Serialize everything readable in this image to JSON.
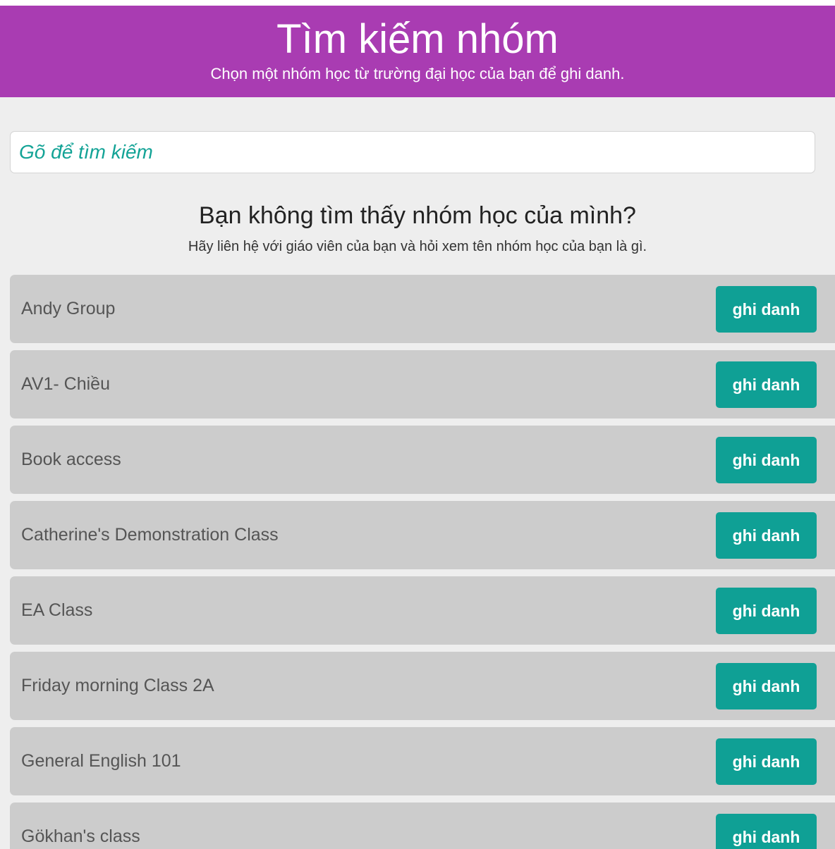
{
  "header": {
    "title": "Tìm kiếm nhóm",
    "subtitle": "Chọn một nhóm học từ trường đại học của bạn để ghi danh."
  },
  "search": {
    "placeholder": "Gõ để tìm kiếm",
    "value": ""
  },
  "not_found": {
    "title": "Bạn không tìm thấy nhóm học của mình?",
    "subtitle": "Hãy liên hệ với giáo viên của bạn và hỏi xem tên nhóm học của bạn là gì."
  },
  "groups": [
    {
      "name": "Andy Group",
      "button_label": "ghi danh"
    },
    {
      "name": "AV1- Chiều",
      "button_label": "ghi danh"
    },
    {
      "name": "Book access",
      "button_label": "ghi danh"
    },
    {
      "name": "Catherine's Demonstration Class",
      "button_label": "ghi danh"
    },
    {
      "name": "EA Class",
      "button_label": "ghi danh"
    },
    {
      "name": "Friday morning Class 2A",
      "button_label": "ghi danh"
    },
    {
      "name": "General English 101",
      "button_label": "ghi danh"
    },
    {
      "name": "Gökhan's class",
      "button_label": "ghi danh"
    }
  ],
  "colors": {
    "header_bg": "#a93cb2",
    "accent": "#0fa095",
    "row_bg": "#cccccc",
    "page_bg": "#eeeeee"
  }
}
